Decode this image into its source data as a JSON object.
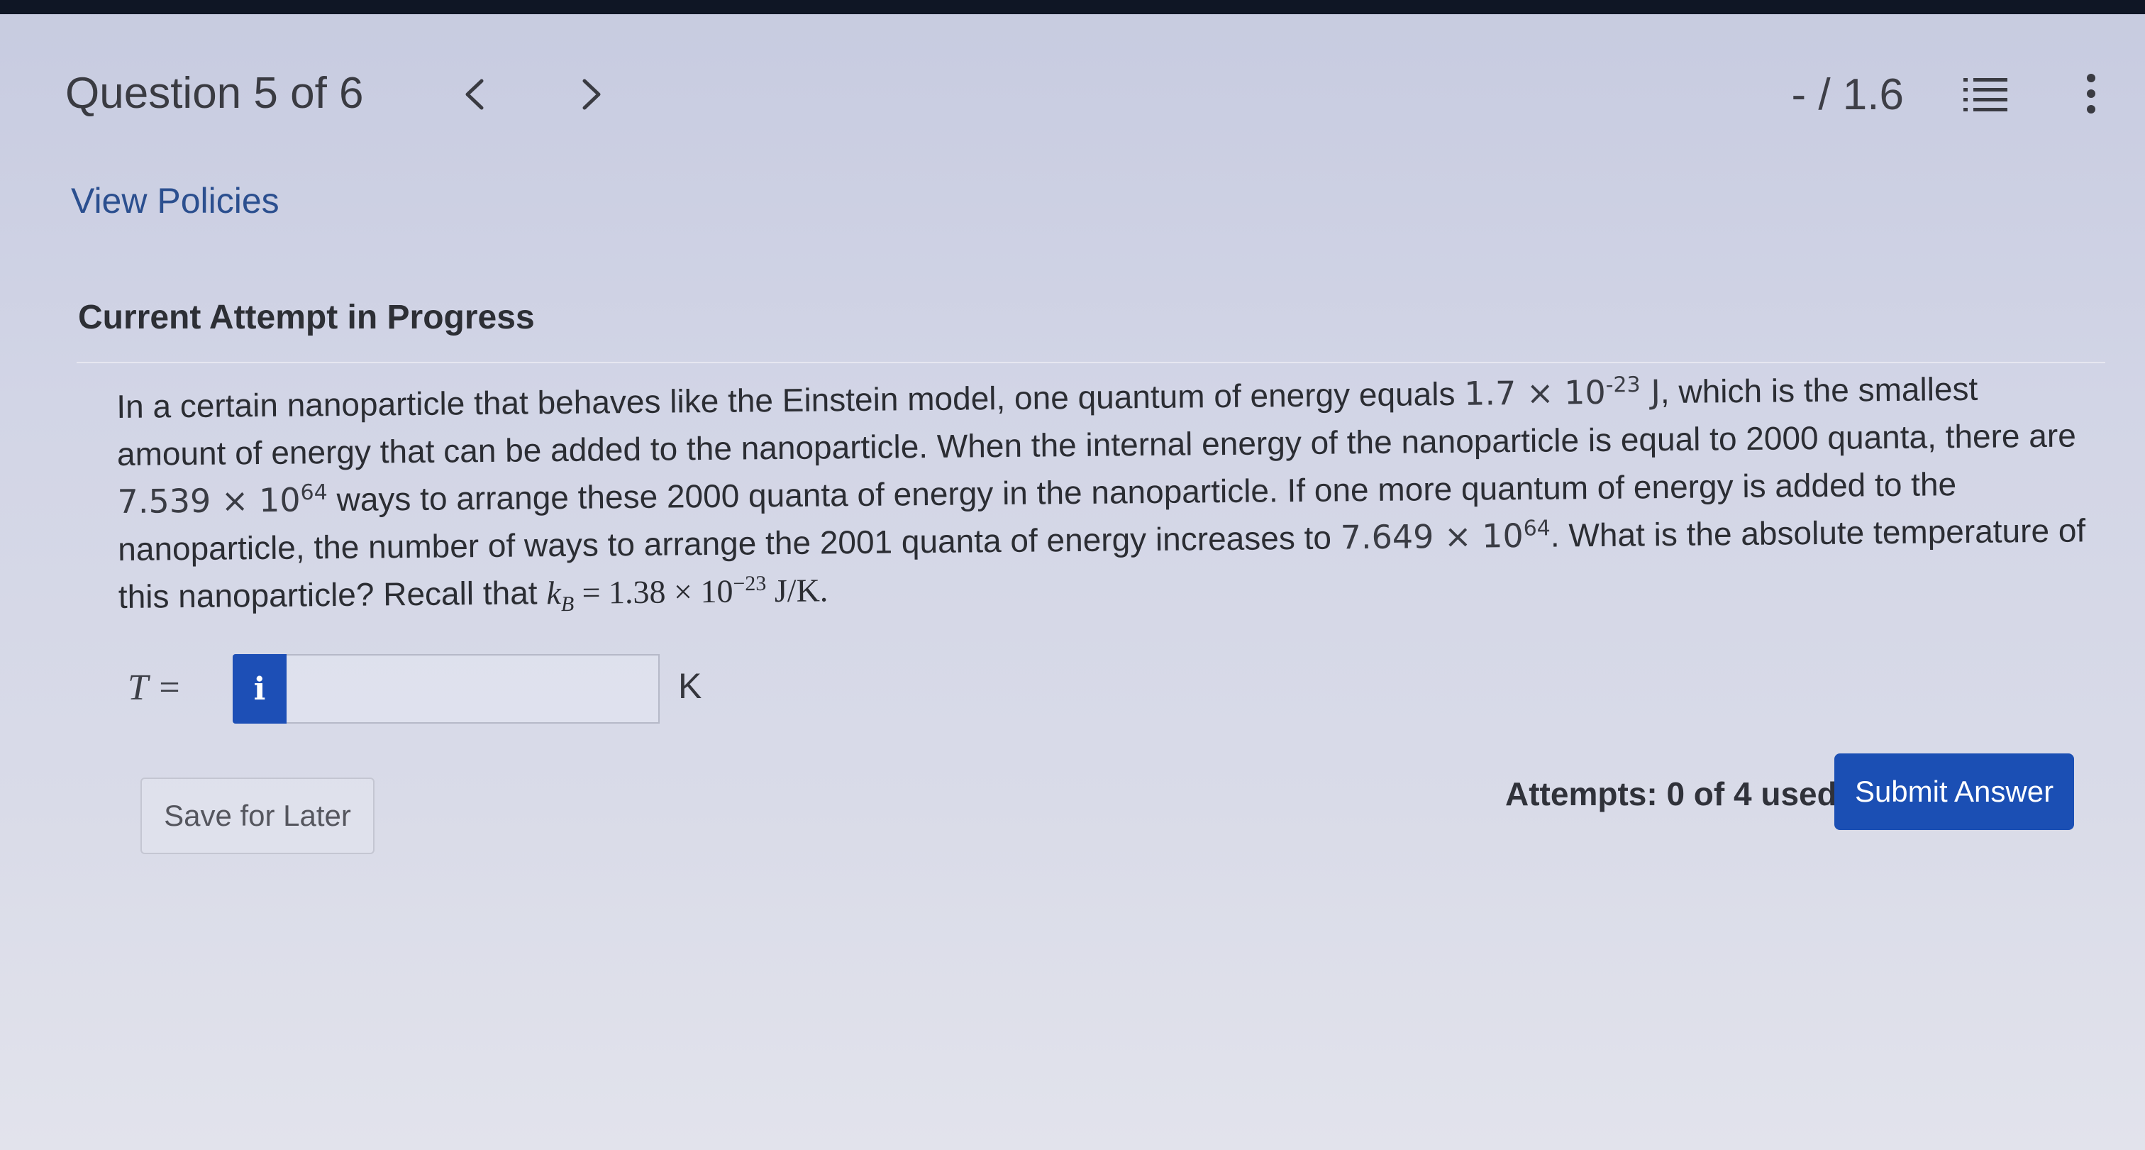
{
  "header": {
    "question_counter": "Question 5 of 6",
    "prev_icon": "chevron-left-icon",
    "next_icon": "chevron-right-icon",
    "score": "- / 1.6",
    "list_icon": "list-icon",
    "more_icon": "more-vertical-icon"
  },
  "policies_link": "View Policies",
  "attempt_heading": "Current Attempt in Progress",
  "question": {
    "part1": "In a certain nanoparticle that behaves like the Einstein model, one quantum of energy equals ",
    "quantum_base": "1.7 × 10",
    "quantum_exp": "-23",
    "quantum_unit": " J",
    "part2": ", which is the smallest amount of energy that can be added to the nanoparticle. When the internal energy of the nanoparticle is equal to 2000 quanta, there are ",
    "ways1_base": "7.539 × 10",
    "ways1_exp": "64",
    "part3": " ways to arrange these 2000 quanta of energy in the nanoparticle. If one more quantum of energy is added to the nanoparticle, the number of ways to arrange the 2001 quanta of energy increases to ",
    "ways2_base": "7.649 × 10",
    "ways2_exp": "64",
    "part4": ". What is the absolute temperature of this nanoparticle? Recall that ",
    "kb_symbol": "k",
    "kb_sub": "B",
    "kb_value": " = 1.38 × 10",
    "kb_exp": "−23",
    "kb_unit": " J/K."
  },
  "answer": {
    "variable_label": "T =",
    "info_badge": "i",
    "input_value": "",
    "input_placeholder": "",
    "unit": "K"
  },
  "footer": {
    "save_label": "Save for Later",
    "attempts_text": "Attempts: 0 of 4 used",
    "submit_label": "Submit Answer"
  },
  "colors": {
    "accent": "#1b4fb4",
    "link": "#2b4f8f",
    "top_bar": "#0f1625"
  }
}
